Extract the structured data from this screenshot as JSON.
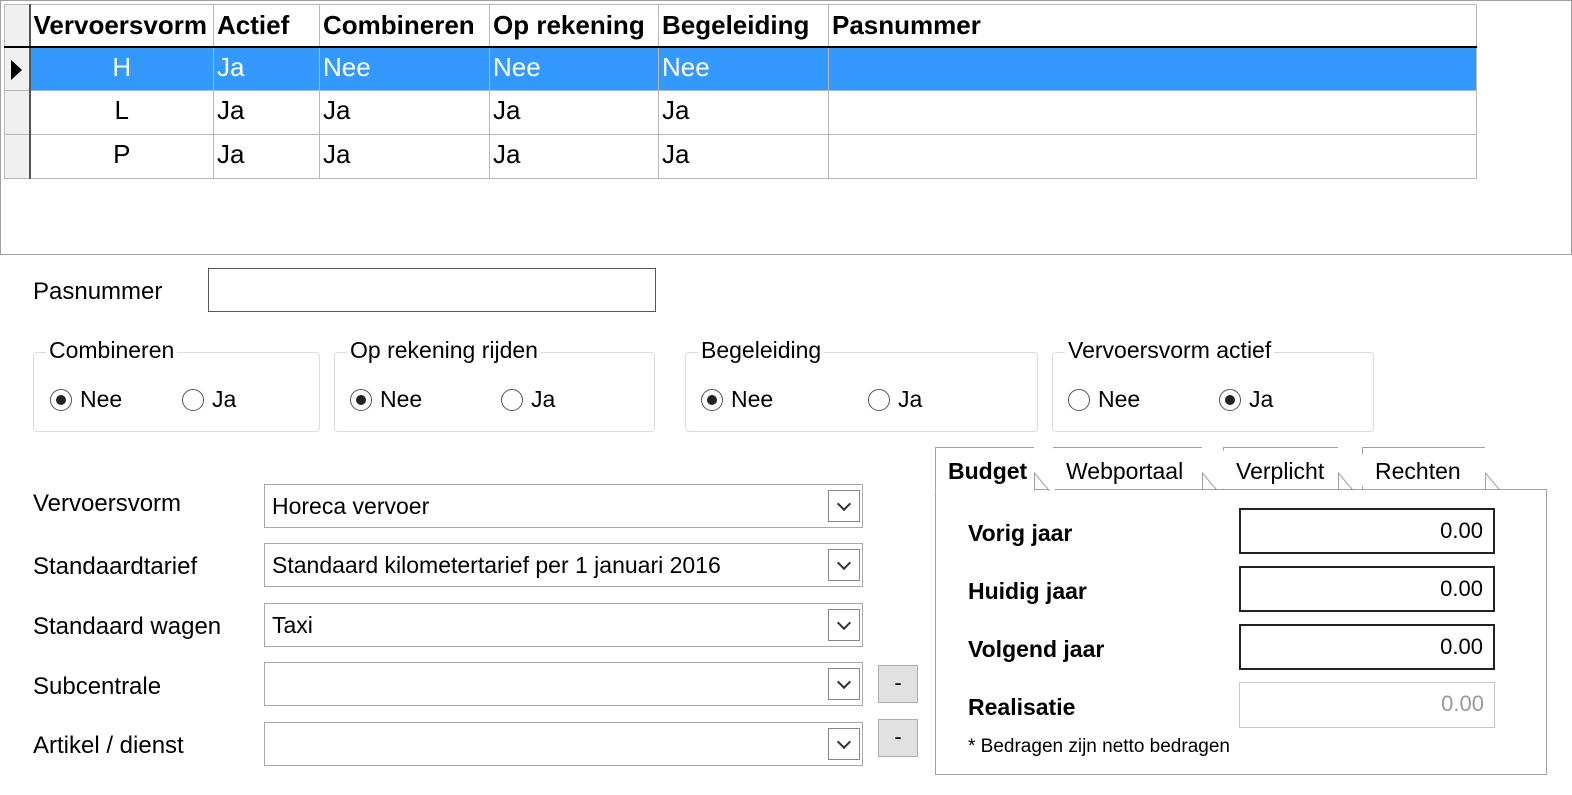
{
  "grid": {
    "columns": [
      "Vervoersvorm",
      "Actief",
      "Combineren",
      "Op rekening",
      "Begeleiding",
      "Pasnummer"
    ],
    "rows": [
      {
        "code": "H",
        "actief": "Ja",
        "combineren": "Nee",
        "op_rekening": "Nee",
        "begeleiding": "Nee",
        "pasnummer": "",
        "selected": true
      },
      {
        "code": "L",
        "actief": "Ja",
        "combineren": "Ja",
        "op_rekening": "Ja",
        "begeleiding": "Ja",
        "pasnummer": "",
        "selected": false
      },
      {
        "code": "P",
        "actief": "Ja",
        "combineren": "Ja",
        "op_rekening": "Ja",
        "begeleiding": "Ja",
        "pasnummer": "",
        "selected": false
      }
    ]
  },
  "form": {
    "pasnummer_label": "Pasnummer",
    "pasnummer_value": "",
    "groups": [
      {
        "title": "Combineren",
        "options": [
          "Nee",
          "Ja"
        ],
        "selected": "Nee"
      },
      {
        "title": "Op rekening rijden",
        "options": [
          "Nee",
          "Ja"
        ],
        "selected": "Nee"
      },
      {
        "title": "Begeleiding",
        "options": [
          "Nee",
          "Ja"
        ],
        "selected": "Nee"
      },
      {
        "title": "Vervoersvorm actief",
        "options": [
          "Nee",
          "Ja"
        ],
        "selected": "Ja"
      }
    ],
    "fields": [
      {
        "label": "Vervoersvorm",
        "value": "Horeca vervoer"
      },
      {
        "label": "Standaardtarief",
        "value": "Standaard kilometertarief per 1 januari 2016"
      },
      {
        "label": "Standaard wagen",
        "value": "Taxi"
      },
      {
        "label": "Subcentrale",
        "value": "",
        "minus_label": "-"
      },
      {
        "label": "Artikel / dienst",
        "value": "",
        "minus_label": "-"
      }
    ]
  },
  "tabs": {
    "items": [
      "Budget",
      "Webportaal",
      "Verplicht",
      "Rechten"
    ],
    "active": "Budget",
    "budget": {
      "rows": [
        {
          "label": "Vorig jaar",
          "value": "0.00",
          "enabled": true
        },
        {
          "label": "Huidig jaar",
          "value": "0.00",
          "enabled": true
        },
        {
          "label": "Volgend jaar",
          "value": "0.00",
          "enabled": true
        },
        {
          "label": "Realisatie",
          "value": "0.00",
          "enabled": false
        }
      ],
      "note": "* Bedragen zijn netto bedragen"
    }
  },
  "colors": {
    "selection": "#3399ff"
  }
}
